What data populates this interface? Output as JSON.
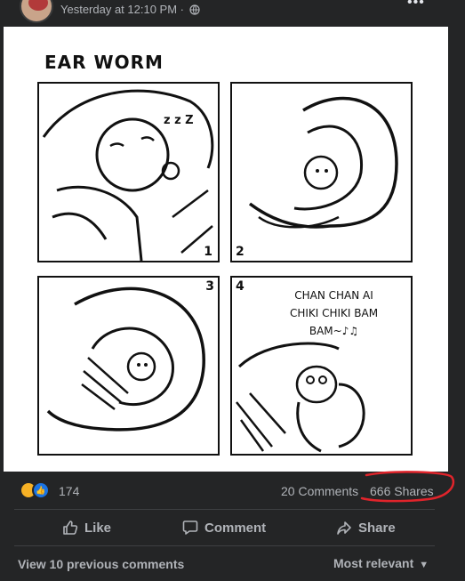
{
  "post": {
    "time": "Yesterday at 12:10 PM ·"
  },
  "comic": {
    "title": "EAR WORM",
    "panel_numbers": [
      "1",
      "2",
      "3",
      "4"
    ],
    "sleep_text": "z z Z",
    "speech_lines": [
      "CHAN CHAN AI",
      "CHIKI CHIKI BAM",
      "BAM~♪♫"
    ]
  },
  "stats": {
    "reaction_count": "174",
    "comments": "20 Comments",
    "shares": "666 Shares"
  },
  "actions": {
    "like": "Like",
    "comment": "Comment",
    "share": "Share"
  },
  "comments": {
    "view_previous": "View 10 previous comments",
    "sort": "Most relevant"
  },
  "colors": {
    "background": "#242526",
    "text": "#b0b3b8",
    "annotation": "#e0242b"
  }
}
